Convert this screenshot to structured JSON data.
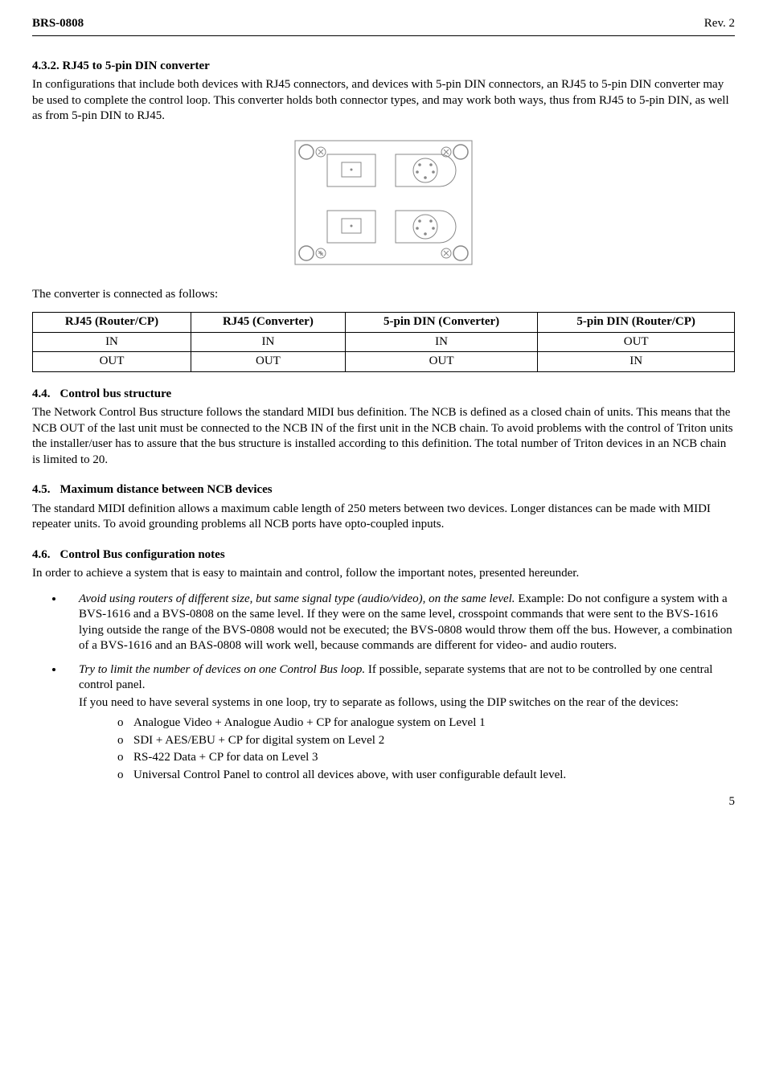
{
  "header": {
    "left": "BRS-0808",
    "right": "Rev. 2"
  },
  "s432": {
    "heading": "4.3.2.   RJ45 to 5-pin DIN converter",
    "body": "In configurations that include both devices with RJ45 connectors, and devices with 5-pin DIN connectors, an RJ45 to 5-pin DIN converter may be used to complete the control loop. This converter holds both connector types, and may work both ways, thus from RJ45 to 5-pin DIN, as well as from 5-pin DIN to RJ45."
  },
  "table_intro": "The converter is connected as follows:",
  "table": {
    "headers": [
      "RJ45 (Router/CP)",
      "RJ45 (Converter)",
      "5-pin DIN (Converter)",
      "5-pin DIN (Router/CP)"
    ],
    "rows": [
      [
        "IN",
        "IN",
        "IN",
        "OUT"
      ],
      [
        "OUT",
        "OUT",
        "OUT",
        "IN"
      ]
    ]
  },
  "s44": {
    "num": "4.4.",
    "title": "Control bus structure",
    "body": "The Network Control Bus structure follows the standard MIDI bus definition. The NCB is defined as a closed chain of units. This means that the NCB OUT of the last unit must be connected to the NCB IN of the first unit in the NCB chain. To avoid problems with the control of Triton units the installer/user has to assure that the bus structure is installed according to this definition. The total number of Triton devices in an NCB chain is limited to 20."
  },
  "s45": {
    "num": "4.5.",
    "title": "Maximum distance between NCB devices",
    "body": "The standard MIDI definition allows a maximum cable length of 250 meters between two devices. Longer distances can be made with MIDI repeater units. To avoid grounding problems all NCB ports have opto-coupled inputs."
  },
  "s46": {
    "num": "4.6.",
    "title": "Control Bus configuration notes",
    "body": "In order to achieve a system that is easy to maintain and control, follow the important notes, presented hereunder."
  },
  "bullets": {
    "b1_em": "Avoid using routers of different size, but same signal type (audio/video), on the same level.",
    "b1_rest": " Example: Do not configure a system with a BVS-1616 and a BVS-0808 on the same level. If they were on the same level, crosspoint commands that were sent to the BVS-1616 lying outside the range of the BVS-0808 would not be executed; the BVS-0808 would throw them off the bus. However, a combination of a BVS-1616 and an BAS-0808 will work well, because commands are different for video- and audio routers.",
    "b2_em": "Try to limit the number of devices on one Control Bus loop.",
    "b2_rest": " If possible, separate systems that are not to be controlled by one central control panel.",
    "b2_more": "If you need to have several systems in one loop, try to separate as follows, using the DIP switches on the rear of the devices:",
    "sub": [
      "Analogue Video + Analogue Audio + CP for analogue system on Level 1",
      "SDI + AES/EBU + CP for digital system on Level 2",
      "RS-422 Data + CP for data on Level 3",
      "Universal Control Panel to control all devices above, with user configurable default level."
    ]
  },
  "page_number": "5"
}
